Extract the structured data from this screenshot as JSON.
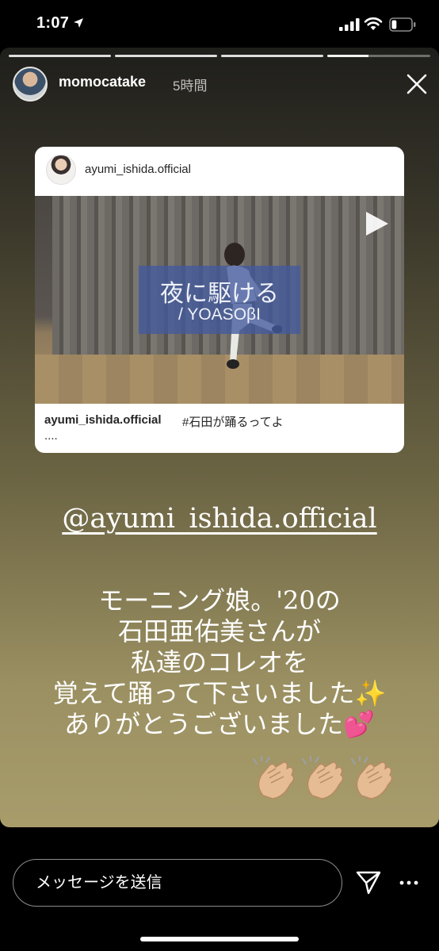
{
  "status_bar": {
    "time": "1:07",
    "battery_level": 0.25
  },
  "story": {
    "progress_segments": [
      1.0,
      1.0,
      1.0,
      0.4
    ],
    "username": "momocatake",
    "time_ago": "5時間"
  },
  "post": {
    "username": "ayumi_ishida.official",
    "video_title": "夜に駆ける",
    "video_subtitle": "/ YOASOβI",
    "caption_user": "ayumi_ishida.official",
    "caption_text": "#石田が踊るってよ",
    "caption_more": "...."
  },
  "text": {
    "mention": "@ayumi_ishida.official",
    "lines": [
      "モーニング娘。'20の",
      "石田亜佑美さんが",
      "私達のコレオを",
      "覚えて踊って下さいました✨",
      "ありがとうございました💕"
    ]
  },
  "reply": {
    "placeholder": "メッセージを送信"
  },
  "icons": [
    "navigation-arrow-icon",
    "signal-icon",
    "wifi-icon",
    "battery-icon",
    "close-icon",
    "play-icon",
    "clapping-hands-icon",
    "send-icon",
    "more-icon"
  ]
}
